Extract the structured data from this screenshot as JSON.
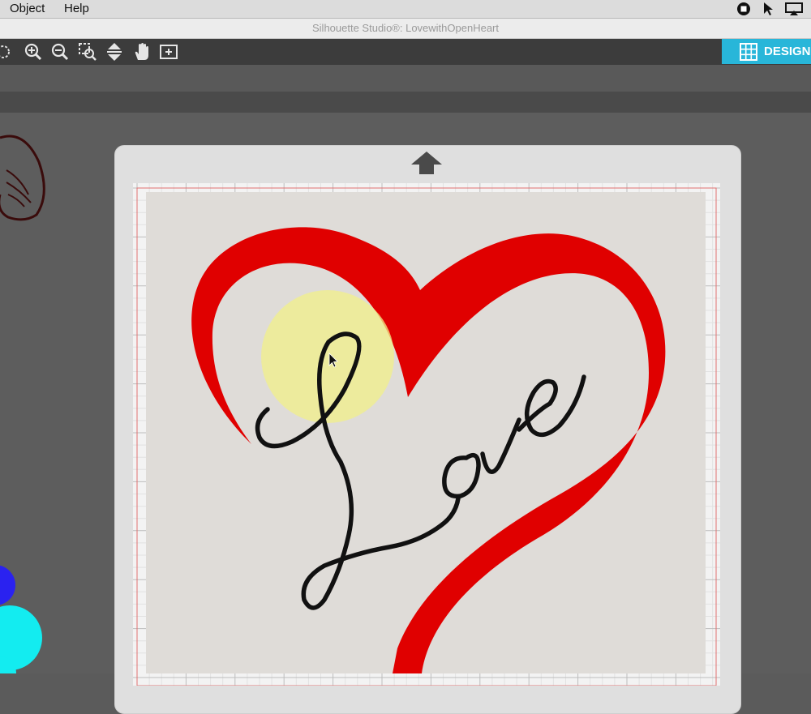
{
  "menubar": {
    "items": [
      "Object",
      "Help"
    ]
  },
  "window": {
    "title": "Silhouette Studio®: LovewithOpenHeart"
  },
  "toolbar": {
    "icons": [
      "zoom-in-icon",
      "zoom-out-icon",
      "zoom-selection-icon",
      "fit-to-page-icon",
      "pan-hand-icon",
      "add-page-icon"
    ]
  },
  "tabs": {
    "design_label": "DESIGN"
  },
  "artwork": {
    "text": "Love",
    "heart_color": "#e00000",
    "text_color": "#111111",
    "highlight_color": "#f2f08a"
  },
  "colors": {
    "accent": "#28b6d9",
    "workspace": "#5d5d5d",
    "mat": "#dfdfdf"
  }
}
